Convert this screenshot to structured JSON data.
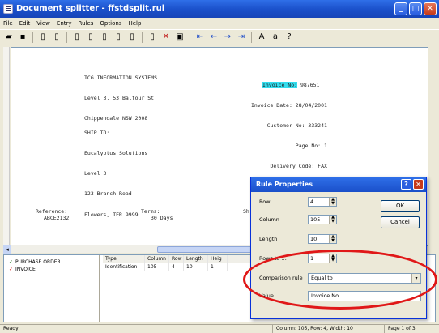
{
  "window": {
    "title": "Document splitter - ffstdsplit.rul",
    "buttons": [
      "_",
      "□",
      "✕"
    ]
  },
  "menu": [
    "File",
    "Edit",
    "View",
    "Entry",
    "Rules",
    "Options",
    "Help"
  ],
  "toolbar": {
    "icons": [
      "open-icon",
      "save-icon",
      "page-icon",
      "page-icon",
      "page-icon",
      "page-icon",
      "page-icon",
      "page-icon",
      "page-icon",
      "delete-icon",
      "properties-icon",
      "arrow-first-icon",
      "arrow-prev-icon",
      "arrow-next-icon",
      "arrow-last-icon",
      "font-up-icon",
      "font-down-icon",
      "help-icon"
    ]
  },
  "document": {
    "sender": [
      "TCG INFORMATION SYSTEMS",
      "Level 3, 53 Balfour St",
      "Chippendale NSW 2008"
    ],
    "invoice_label": "Invoice No:",
    "invoice_no": "987651",
    "details": [
      "Invoice Date: 28/04/2001",
      "Customer No: 333241",
      "Page No: 1",
      "Delivery Code: FAX"
    ],
    "ship_to": [
      "SHIP TO:",
      "Eucalyptus Solutions",
      "Level 3",
      "123 Branch Road",
      "Flowers, TER 9999"
    ],
    "ref_label": "Reference:",
    "ref_value": "ABCE2132",
    "terms_label": "Terms:",
    "terms_value": "30 Days",
    "sh_fragment": "Sh"
  },
  "tree": {
    "items": [
      {
        "label": "PURCHASE ORDER",
        "color": "#2a7a2a"
      },
      {
        "label": "INVOICE",
        "color": "#d01818"
      }
    ]
  },
  "grid": {
    "headers": [
      "Type",
      "Column",
      "Row",
      "Length",
      "Heig"
    ],
    "rows": [
      [
        "Identification",
        "105",
        "4",
        "10",
        "1"
      ]
    ]
  },
  "status": {
    "left": "Ready",
    "mid": "Column: 105, Row: 4, Width: 10",
    "right": "Page 1 of 3"
  },
  "dialog": {
    "title": "Rule Properties",
    "row_label": "Row",
    "row_value": "4",
    "column_label": "Column",
    "column_value": "105",
    "length_label": "Length",
    "length_value": "10",
    "rows_label": "Rows to ...",
    "rows_value": "1",
    "comparison_label": "Comparison rule",
    "comparison_value": "Equal to",
    "value_label": "Value",
    "value_value": "Invoice No",
    "ok_label": "OK",
    "cancel_label": "Cancel"
  }
}
